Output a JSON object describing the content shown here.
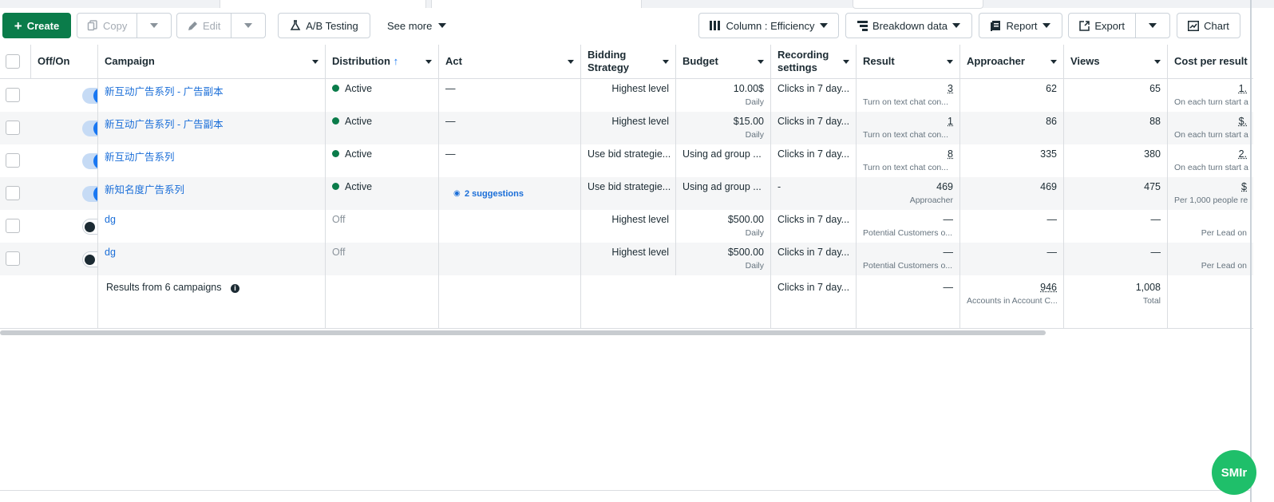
{
  "toolbar": {
    "create": "Create",
    "copy": "Copy",
    "edit": "Edit",
    "ab_testing": "A/B Testing",
    "see_more": "See more",
    "column": "Column : Efficiency",
    "breakdown": "Breakdown data",
    "report": "Report",
    "export": "Export",
    "chart": "Chart"
  },
  "headers": {
    "offon": "Off/On",
    "campaign": "Campaign",
    "distribution": "Distribution",
    "act": "Act",
    "bidding": "Bidding Strategy",
    "budget": "Budget",
    "recording": "Recording settings",
    "result": "Result",
    "approacher": "Approacher",
    "views": "Views",
    "cost": "Cost per result"
  },
  "rows": [
    {
      "campaign": "新互动广告系列 - 广告副本",
      "distribution": "Active",
      "act": "—",
      "bidding": "Highest level",
      "budget": "10.00$",
      "budget_sub": "Daily",
      "recording": "Clicks in 7 day...",
      "result": "3",
      "result_sub": "Turn on text chat con...",
      "approacher": "62",
      "views": "65",
      "cost": "1.",
      "cost_sub": "On each turn start a"
    },
    {
      "campaign": "新互动广告系列 - 广告副本",
      "distribution": "Active",
      "act": "—",
      "bidding": "Highest level",
      "budget": "$15.00",
      "budget_sub": "Daily",
      "recording": "Clicks in 7 day...",
      "result": "1",
      "result_sub": "Turn on text chat con...",
      "approacher": "86",
      "views": "88",
      "cost": "$.",
      "cost_sub": "On each turn start a"
    },
    {
      "campaign": "新互动广告系列",
      "distribution": "Active",
      "act": "—",
      "bidding": "Use bid strategie...",
      "budget": "Using ad group ...",
      "budget_sub": "",
      "recording": "Clicks in 7 day...",
      "result": "8",
      "result_sub": "Turn on text chat con...",
      "approacher": "335",
      "views": "380",
      "cost": "2.",
      "cost_sub": "On each turn start a"
    },
    {
      "campaign": "新知名度广告系列",
      "distribution": "Active",
      "act": "2 suggestions",
      "bidding": "Use bid strategie...",
      "budget": "Using ad group ...",
      "budget_sub": "",
      "recording": "-",
      "result": "469",
      "result_sub": "Approacher",
      "approacher": "469",
      "views": "475",
      "cost": "$",
      "cost_sub": "Per 1,000 people re"
    },
    {
      "campaign": "dg",
      "distribution": "Off",
      "act": "",
      "bidding": "Highest level",
      "budget": "$500.00",
      "budget_sub": "Daily",
      "recording": "Clicks in 7 day...",
      "result": "—",
      "result_sub": "Potential Customers o...",
      "approacher": "—",
      "views": "—",
      "cost": "",
      "cost_sub": "Per Lead on"
    },
    {
      "campaign": "dg",
      "distribution": "Off",
      "act": "",
      "bidding": "Highest level",
      "budget": "$500.00",
      "budget_sub": "Daily",
      "recording": "Clicks in 7 day...",
      "result": "—",
      "result_sub": "Potential Customers o...",
      "approacher": "—",
      "views": "—",
      "cost": "",
      "cost_sub": "Per Lead on"
    }
  ],
  "totals": {
    "label": "Results from 6 campaigns",
    "recording": "Clicks in 7 day...",
    "result": "—",
    "approacher": "946",
    "approacher_sub": "Accounts in Account C...",
    "views": "1,008",
    "views_sub": "Total"
  },
  "badge": "SMIr",
  "colors": {
    "primary": "#0a7c4a",
    "link": "#1a6ed8",
    "toggle_on": "#1877f2"
  }
}
